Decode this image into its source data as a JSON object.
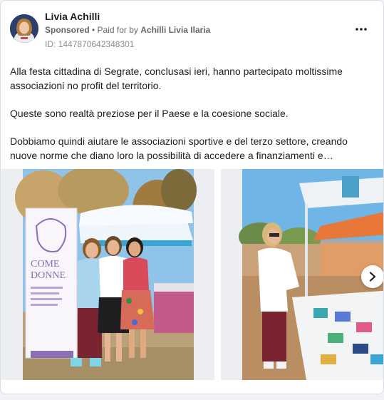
{
  "post": {
    "author": "Livia Achilli",
    "sponsored_label": "Sponsored",
    "separator": " • ",
    "paid_for_label": "Paid for by",
    "payer": "Achilli Livia Ilaria",
    "ad_id": "ID: 1447870642348301",
    "more_icon": "more-horizontal-icon",
    "paragraphs": [
      "Alla festa cittadina di Segrate, conclusasi ieri, hanno partecipato moltissime associazioni no profit del territorio.",
      "Queste sono realtà preziose per il Paese e la coesione sociale.",
      "Dobbiamo quindi aiutare le associazioni sportive e del terzo settore, creando nuove norme che diano loro la possibilità di accedere a finanziamenti e…"
    ]
  },
  "carousel": {
    "banner_text_1": "COME",
    "banner_text_2": "DONNE",
    "next_icon": "chevron-right-icon"
  },
  "colors": {
    "sky": "#8fc3e8",
    "tent": "#3aa6d8",
    "orange_tent": "#e8783a",
    "banner_purple": "#8a6fb3"
  }
}
